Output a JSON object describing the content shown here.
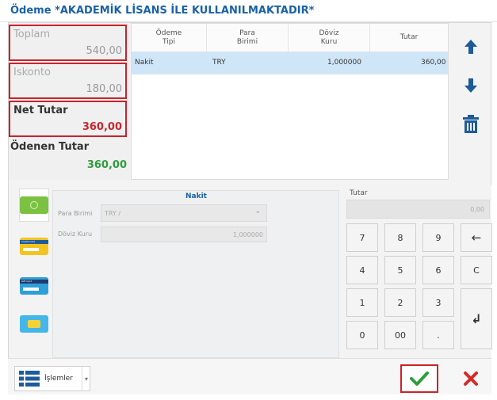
{
  "title": "Ödeme *AKADEMİK LİSANS İLE KULLANILMAKTADIR*",
  "summary": {
    "toplam_label": "Toplam",
    "toplam_value": "540,00",
    "iskonto_label": "Iskonto",
    "iskonto_value": "180,00",
    "net_label": "Net Tutar",
    "net_value": "360,00",
    "odenen_label": "Ödenen Tutar",
    "odenen_value": "360,00"
  },
  "grid": {
    "headers": {
      "tip_1": "Ödeme",
      "tip_2": "Tipi",
      "para_1": "Para",
      "para_2": "Birimi",
      "doviz_1": "Döviz",
      "doviz_2": "Kuru",
      "tutar": "Tutar"
    },
    "row": {
      "tip": "Nakit",
      "para": "TRY",
      "kur": "1,000000",
      "tutar": "360,00"
    }
  },
  "icons": {
    "up": "arrow-up-icon",
    "down": "arrow-down-icon",
    "delete": "trash-icon",
    "menu": "list-icon",
    "confirm": "checkmark-icon",
    "cancel": "close-icon"
  },
  "tabs": {
    "credit_card": "Credit Card",
    "gift_card": "Gift Card"
  },
  "nakit_panel": {
    "header": "Nakit",
    "para_label": "Para Birimi",
    "para_value": "TRY /",
    "kur_label": "Döviz Kuru",
    "kur_value": "1,000000"
  },
  "numpad": {
    "header": "Tutar",
    "display": "0,00",
    "keys": {
      "k7": "7",
      "k8": "8",
      "k9": "9",
      "backspace": "←",
      "k4": "4",
      "k5": "5",
      "k6": "6",
      "clear": "C",
      "k1": "1",
      "k2": "2",
      "k3": "3",
      "enter": "↲",
      "k0": "0",
      "k00": "00",
      "dot": "."
    }
  },
  "bottom": {
    "islemler": "İşlemler",
    "dropdown": "▾"
  },
  "colors": {
    "accent_blue": "#1a62a6",
    "highlight_red": "#cc2229",
    "net_value_red": "#c8282e",
    "paid_green": "#2e9d3e",
    "selected_row": "#cfe6f8"
  }
}
